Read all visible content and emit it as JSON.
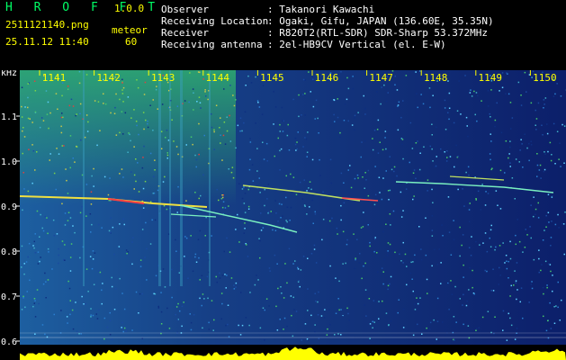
{
  "app": {
    "logo": "H R O F F T",
    "version": "1.0.0"
  },
  "file": {
    "name": "2511121140.png",
    "datetime": "25.11.12 11:40"
  },
  "mode": {
    "label": "meteor",
    "count": "60"
  },
  "info": [
    {
      "key": "Observer",
      "sep": ": ",
      "value": "Takanori Kawachi"
    },
    {
      "key": "Receiving Location",
      "sep": ": ",
      "value": "Ogaki, Gifu, JAPAN (136.60E, 35.35N)"
    },
    {
      "key": "Receiver",
      "sep": ": ",
      "value": "R820T2(RTL-SDR) SDR-Sharp 53.372MHz"
    },
    {
      "key": "Receiving antenna",
      "sep": ": ",
      "value": "2el-HB9CV Vertical (el. E-W)"
    }
  ],
  "axis": {
    "unit": "kHz",
    "y_ticks": [
      "1.1",
      "1.0",
      "0.9",
      "0.8",
      "0.7",
      "0.6"
    ],
    "x_ticks": [
      "1141",
      "1142",
      "1143",
      "1144",
      "1145",
      "1146",
      "1147",
      "1148",
      "1149",
      "1150"
    ]
  },
  "colors": {
    "bg": "#000000",
    "label": "#ffff00",
    "logo": "#00ff66",
    "text": "#ffffff"
  }
}
